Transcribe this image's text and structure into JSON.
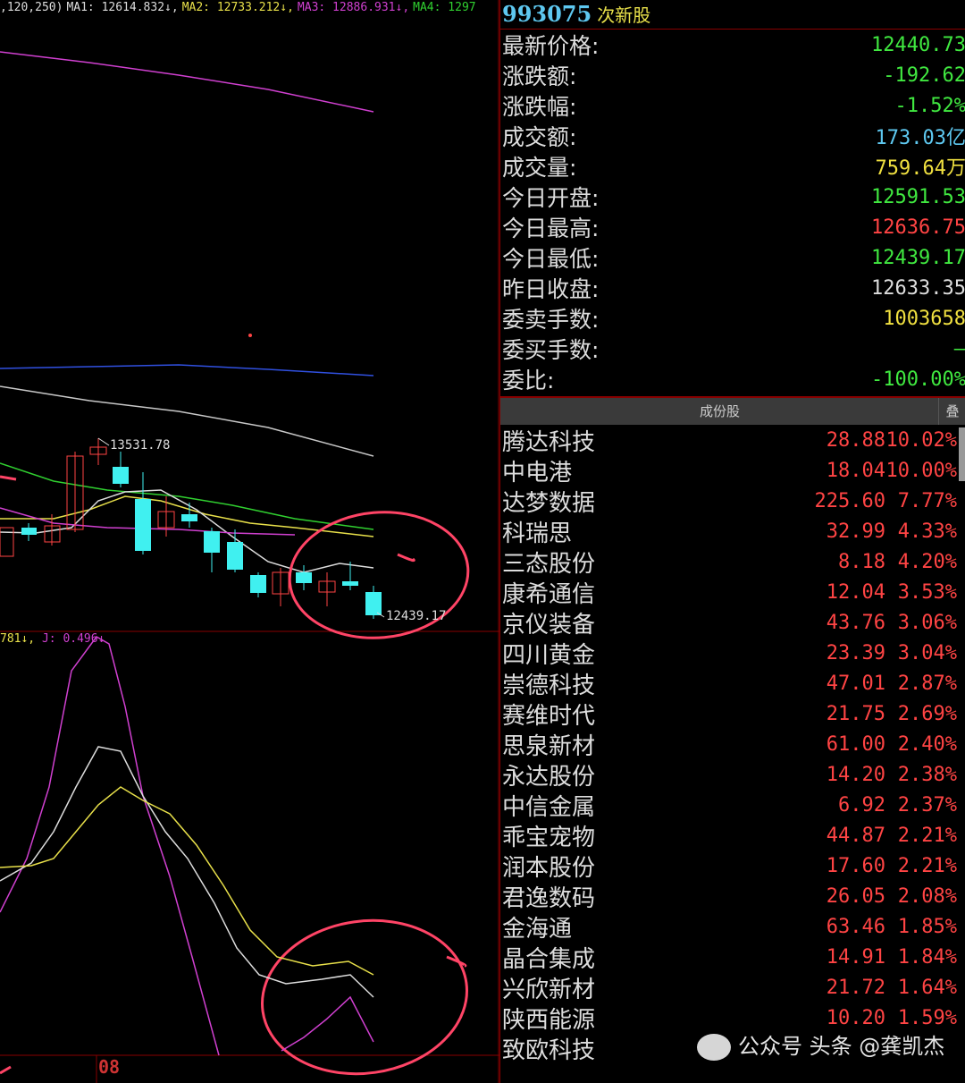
{
  "chart": {
    "ma_header": {
      "params": ",120,250)",
      "ma1": "MA1: 12614.832↓,",
      "ma2": "MA2: 12733.212↓,",
      "ma3": "MA3: 12886.931↓,",
      "ma4": "MA4: 1297"
    },
    "kdj_header": {
      "prefix": "781↓,",
      "j": "J: 0.496↓"
    },
    "high_label": "13531.78",
    "low_label": "12439.17",
    "axis_label": "08",
    "colors": {
      "up": "#ff4444",
      "down": "#40f0f0",
      "ma1": "#dddddd",
      "ma2": "#e8e04a",
      "ma3": "#d040d0",
      "ma4": "#30d030",
      "ma5": "#3050e0",
      "ma6": "#c8c8c8"
    }
  },
  "quote": {
    "code": "993075",
    "name": "次新股",
    "rows": [
      {
        "label": "最新价格:",
        "value": "12440.73",
        "color": "#40e840"
      },
      {
        "label": "涨跌额:",
        "value": "-192.62",
        "color": "#40e840"
      },
      {
        "label": "涨跌幅:",
        "value": "-1.52%",
        "color": "#40e840"
      },
      {
        "label": "成交额:",
        "value": "173.03亿",
        "color": "#5ec8f0"
      },
      {
        "label": "成交量:",
        "value": "759.64万",
        "color": "#f0e040"
      },
      {
        "label": "今日开盘:",
        "value": "12591.53",
        "color": "#40e840"
      },
      {
        "label": "今日最高:",
        "value": "12636.75",
        "color": "#ff4444"
      },
      {
        "label": "今日最低:",
        "value": "12439.17",
        "color": "#40e840"
      },
      {
        "label": "昨日收盘:",
        "value": "12633.35",
        "color": "#dddddd"
      },
      {
        "label": "委卖手数:",
        "value": "1003658",
        "color": "#f0e040"
      },
      {
        "label": "委买手数:",
        "value": "—",
        "color": "#40e840"
      },
      {
        "label": "委比:",
        "value": "-100.00%",
        "color": "#40e840"
      }
    ]
  },
  "components": {
    "title": "成份股",
    "fold_label": "叠",
    "rows": [
      {
        "name": "腾达科技",
        "price": "28.88",
        "pct": "10.02%"
      },
      {
        "name": "中电港",
        "price": "18.04",
        "pct": "10.00%"
      },
      {
        "name": "达梦数据",
        "price": "225.60",
        "pct": "7.77%"
      },
      {
        "name": "科瑞思",
        "price": "32.99",
        "pct": "4.33%"
      },
      {
        "name": "三态股份",
        "price": "8.18",
        "pct": "4.20%"
      },
      {
        "name": "康希通信",
        "price": "12.04",
        "pct": "3.53%"
      },
      {
        "name": "京仪装备",
        "price": "43.76",
        "pct": "3.06%"
      },
      {
        "name": "四川黄金",
        "price": "23.39",
        "pct": "3.04%"
      },
      {
        "name": "崇德科技",
        "price": "47.01",
        "pct": "2.87%"
      },
      {
        "name": "赛维时代",
        "price": "21.75",
        "pct": "2.69%"
      },
      {
        "name": "思泉新材",
        "price": "61.00",
        "pct": "2.40%"
      },
      {
        "name": "永达股份",
        "price": "14.20",
        "pct": "2.38%"
      },
      {
        "name": "中信金属",
        "price": "6.92",
        "pct": "2.37%"
      },
      {
        "name": "乖宝宠物",
        "price": "44.87",
        "pct": "2.21%"
      },
      {
        "name": "润本股份",
        "price": "17.60",
        "pct": "2.21%"
      },
      {
        "name": "君逸数码",
        "price": "26.05",
        "pct": "2.08%"
      },
      {
        "name": "金海通",
        "price": "63.46",
        "pct": "1.85%"
      },
      {
        "name": "晶合集成",
        "price": "14.91",
        "pct": "1.84%"
      },
      {
        "name": "兴欣新材",
        "price": "21.72",
        "pct": "1.64%"
      },
      {
        "name": "陕西能源",
        "price": "10.20",
        "pct": "1.59%"
      },
      {
        "name": "致欧科技",
        "price": "",
        "pct": ""
      }
    ]
  },
  "watermark": "公众号 头条 @龚凯杰"
}
